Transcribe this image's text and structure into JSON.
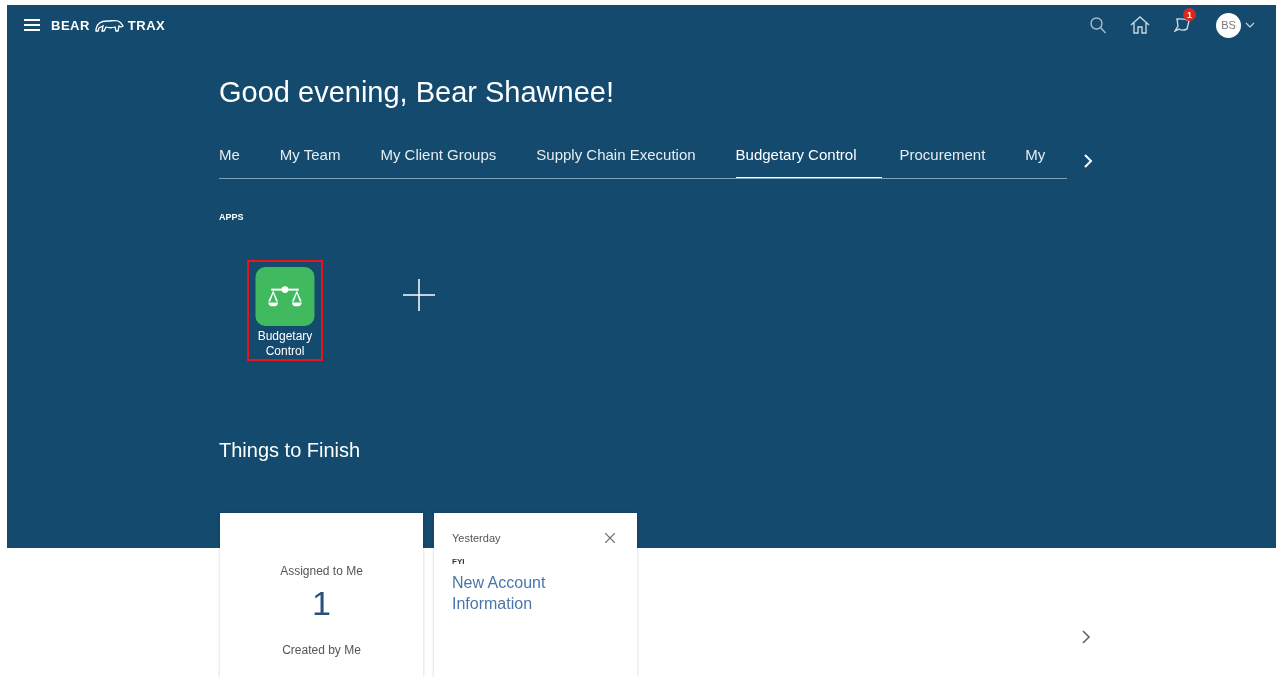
{
  "header": {
    "brand_left": "BEAR",
    "brand_right": "TRAX",
    "notification_count": "1",
    "avatar_initials": "BS"
  },
  "greeting": "Good evening, Bear Shawnee!",
  "tabs": [
    {
      "label": "Me",
      "selected": false
    },
    {
      "label": "My Team",
      "selected": false
    },
    {
      "label": "My Client Groups",
      "selected": false
    },
    {
      "label": "Supply Chain Execution",
      "selected": false
    },
    {
      "label": "Budgetary Control",
      "selected": true
    },
    {
      "label": "Procurement",
      "selected": false
    },
    {
      "label": "My",
      "selected": false
    }
  ],
  "apps": {
    "heading": "APPS",
    "items": [
      {
        "label": "Budgetary Control",
        "highlighted": true
      }
    ]
  },
  "things_to_finish": {
    "title": "Things to Finish",
    "summary_card": {
      "assigned_label": "Assigned to Me",
      "assigned_count": "1",
      "created_label": "Created by Me"
    },
    "notification_card": {
      "when": "Yesterday",
      "tag": "FYI",
      "title": "New Account Information"
    }
  }
}
